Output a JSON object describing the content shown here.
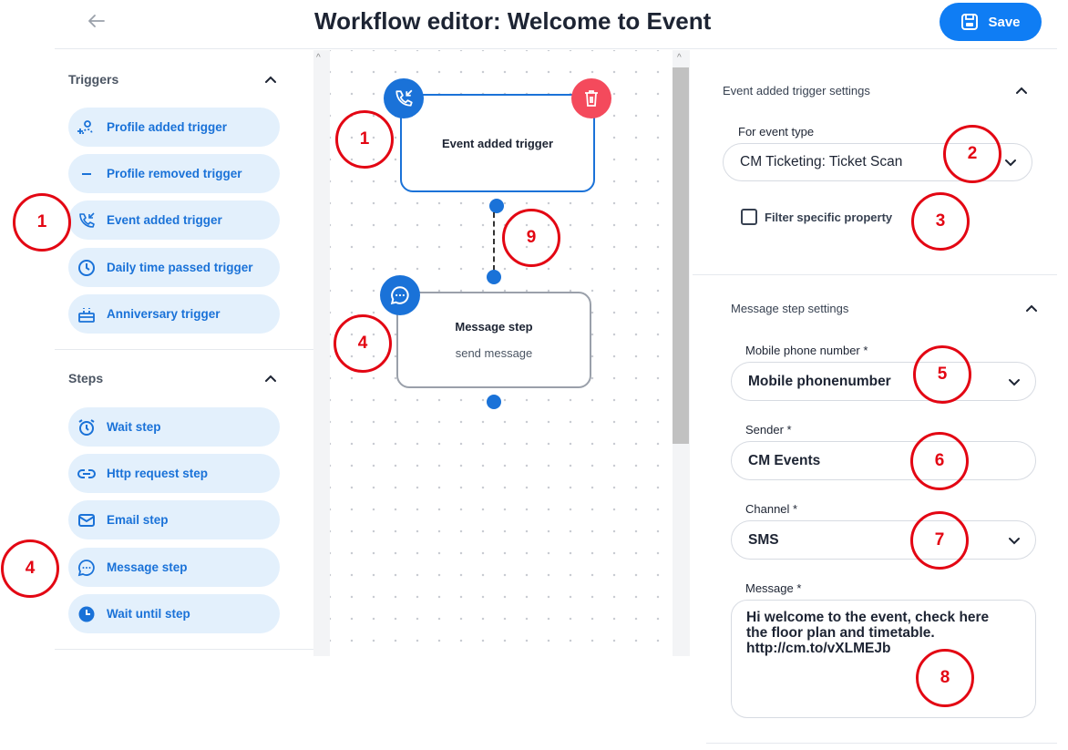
{
  "header": {
    "title": "Workflow editor: Welcome to Event",
    "save_label": "Save",
    "back_icon": "arrow-left-icon",
    "save_icon": "floppy-disk-icon"
  },
  "sidebar": {
    "triggers": {
      "title": "Triggers",
      "items": [
        {
          "label": "Profile added trigger",
          "icon": "user-plus-icon"
        },
        {
          "label": "Profile removed trigger",
          "icon": "minus-icon"
        },
        {
          "label": "Event added trigger",
          "icon": "phone-incoming-icon"
        },
        {
          "label": "Daily time passed trigger",
          "icon": "clock-icon"
        },
        {
          "label": "Anniversary trigger",
          "icon": "cake-icon"
        }
      ]
    },
    "steps": {
      "title": "Steps",
      "items": [
        {
          "label": "Wait step",
          "icon": "alarm-clock-icon"
        },
        {
          "label": "Http request step",
          "icon": "link-icon"
        },
        {
          "label": "Email step",
          "icon": "envelope-icon"
        },
        {
          "label": "Message step",
          "icon": "chat-bubble-icon"
        },
        {
          "label": "Wait until step",
          "icon": "clock-filled-icon"
        }
      ]
    }
  },
  "canvas": {
    "trigger_node": {
      "title": "Event added trigger"
    },
    "message_node": {
      "title": "Message step",
      "subtitle": "send message"
    }
  },
  "panel": {
    "trigger_settings": {
      "title": "Event added trigger settings",
      "event_type_label": "For event type",
      "event_type_value": "CM Ticketing: Ticket Scan",
      "filter_label": "Filter specific property"
    },
    "message_settings": {
      "title": "Message step settings",
      "phone_label": "Mobile phone number *",
      "phone_value": "Mobile phonenumber",
      "sender_label": "Sender *",
      "sender_value": "CM Events",
      "channel_label": "Channel *",
      "channel_value": "SMS",
      "message_label": "Message *",
      "message_value": "Hi welcome to the event, check here\nthe floor plan and timetable.\nhttp://cm.to/vXLMEJb"
    }
  },
  "annotations": {
    "n1": "1",
    "n2": "2",
    "n3": "3",
    "n4": "4",
    "n5": "5",
    "n6": "6",
    "n7": "7",
    "n8": "8",
    "n9": "9"
  },
  "colors": {
    "accent": "#0f7df4",
    "pill_bg": "#e3f0fc",
    "delete": "#f44a5c",
    "annotation": "#e30613"
  }
}
